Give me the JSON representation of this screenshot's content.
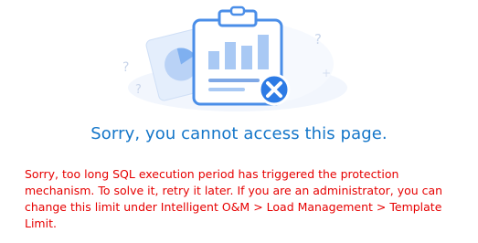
{
  "error": {
    "title": "Sorry, you cannot access this page.",
    "message": "Sorry, too long SQL execution period has triggered the protection mechanism. To solve it, retry it later. If you are an administrator, you can change this limit under Intelligent O&M > Load Management > Template Limit."
  },
  "illustration": {
    "icon": "clipboard-chart-error-icon",
    "decorations": [
      "?",
      "?",
      "?"
    ]
  },
  "colors": {
    "title": "#1476c9",
    "message": "#e60000",
    "illustration_primary": "#4a8ee8",
    "illustration_light": "#dce9fb",
    "error_badge": "#2d7be5"
  }
}
